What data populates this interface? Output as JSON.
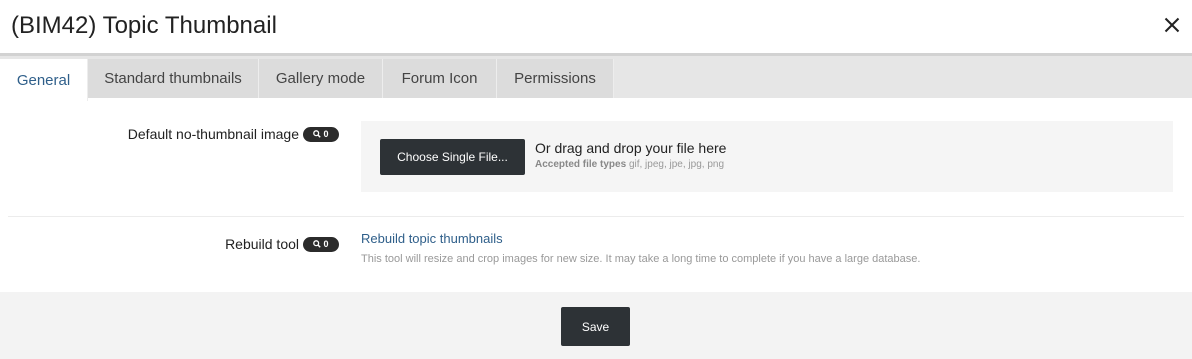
{
  "dialog": {
    "title": "(BIM42) Topic Thumbnail",
    "close_icon": "close-icon"
  },
  "tabs": [
    {
      "label": "General",
      "active": true
    },
    {
      "label": "Standard thumbnails",
      "active": false
    },
    {
      "label": "Gallery mode",
      "active": false
    },
    {
      "label": "Forum Icon",
      "active": false
    },
    {
      "label": "Permissions",
      "active": false
    }
  ],
  "default_image": {
    "label": "Default no-thumbnail image",
    "badge_count": "0",
    "badge_icon": "search-icon",
    "choose_button": "Choose Single File...",
    "drag_text": "Or drag and drop your file here",
    "accepted_label": "Accepted file types",
    "accepted_types": "gif, jpeg, jpe, jpg, png"
  },
  "rebuild": {
    "label": "Rebuild tool",
    "badge_count": "0",
    "badge_icon": "search-icon",
    "link_text": "Rebuild topic thumbnails",
    "help_text": "This tool will resize and crop images for new size. It may take a long time to complete if you have a large database."
  },
  "footer": {
    "save_label": "Save"
  },
  "colors": {
    "accent": "#2f5f8a",
    "button_dark": "#2d3236",
    "tabbar_bg": "#e6e6e6",
    "footer_bg": "#f3f3f3"
  }
}
